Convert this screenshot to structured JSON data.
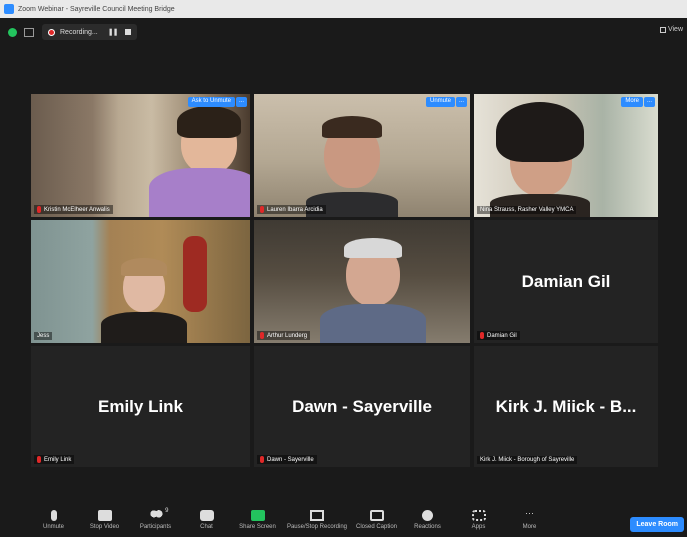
{
  "window": {
    "title": "Zoom Webinar - Sayreville Council Meeting Bridge"
  },
  "topbar": {
    "recording_label": "Recording...",
    "view_label": "View"
  },
  "tiles": [
    {
      "name": "Kristin McElheer Anwalis",
      "button1": "Ask to Unmute",
      "more": "...",
      "has_video": true,
      "active": true
    },
    {
      "name": "Lauren Ibarra Arcidia",
      "button1": "Unmute",
      "more": "...",
      "has_video": true
    },
    {
      "name": "Nina Strauss, Rasher Valley YMCA",
      "button1": "More",
      "more": "...",
      "has_video": true
    },
    {
      "name": "Jess",
      "has_video": true
    },
    {
      "name": "Arthur Lunderg",
      "has_video": true
    },
    {
      "name": "Damian Gil",
      "big_name": "Damian Gil",
      "has_video": false
    },
    {
      "name": "Emily Link",
      "big_name": "Emily Link",
      "has_video": false
    },
    {
      "name": "Dawn - Sayerville",
      "big_name": "Dawn - Sayerville",
      "has_video": false
    },
    {
      "name": "Kirk J. Miick - Borough of Sayreville",
      "big_name": "Kirk J. Miick - B...",
      "has_video": false
    }
  ],
  "toolbar": {
    "items": [
      {
        "label": "Unmute",
        "icon": "microphone-muted-icon"
      },
      {
        "label": "Stop Video",
        "icon": "video-camera-icon"
      },
      {
        "label": "Participants",
        "icon": "participants-icon",
        "count": "9"
      },
      {
        "label": "Chat",
        "icon": "chat-icon"
      },
      {
        "label": "Share Screen",
        "icon": "share-screen-icon"
      },
      {
        "label": "Pause/Stop Recording",
        "icon": "recording-icon"
      },
      {
        "label": "Closed Caption",
        "icon": "closed-caption-icon"
      },
      {
        "label": "Reactions",
        "icon": "reactions-icon"
      },
      {
        "label": "Apps",
        "icon": "apps-icon"
      },
      {
        "label": "More",
        "icon": "more-icon"
      }
    ],
    "leave_label": "Leave Room"
  },
  "colors": {
    "accent": "#2d8cff",
    "active_border": "#e4d54a",
    "muted_red": "#e02828",
    "share_green": "#23c45e"
  }
}
